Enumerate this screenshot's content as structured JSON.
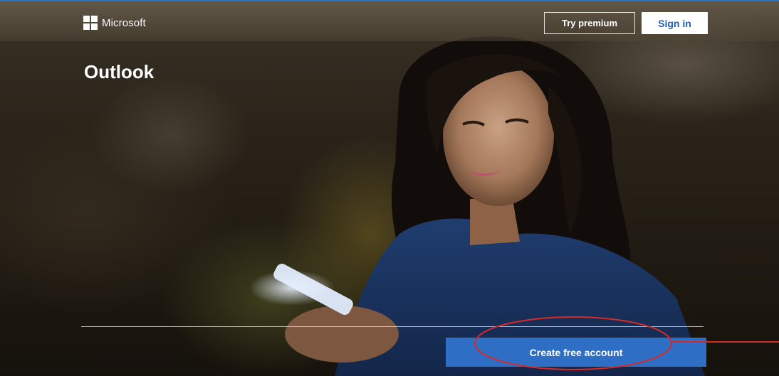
{
  "header": {
    "brand_name": "Microsoft",
    "brand_icon": "microsoft-logo-icon",
    "try_premium_label": "Try premium",
    "sign_in_label": "Sign in"
  },
  "hero": {
    "title": "Outlook"
  },
  "cta": {
    "create_account_label": "Create free account"
  },
  "colors": {
    "accent_top_border": "#2d6ec9",
    "cta_background": "#2e6ec4",
    "signin_text": "#1f5fb8",
    "annotation_red": "#d42a2a"
  }
}
